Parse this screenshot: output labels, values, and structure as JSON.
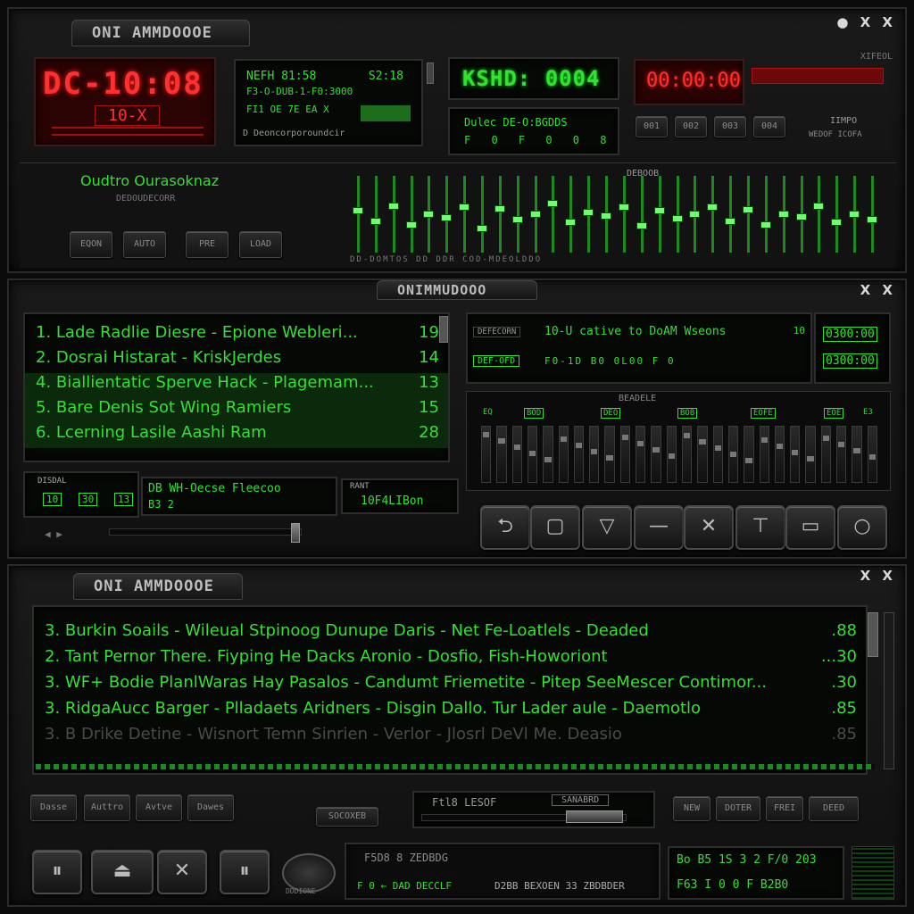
{
  "brand": "ONI AMMDOOOE",
  "brand_mid": "ONIMMUDOOO",
  "window_controls": "● X X",
  "top": {
    "red_display": "DC-10:08",
    "red_sub": "10-X",
    "info_line1": "NEFH 81:58",
    "info_line1_right": "S2:18",
    "info_line2": "F3-O-DUB-1-F0:3000",
    "info_line3": "FI1 OE 7E EA X",
    "info_line4": "D Deoncorporoundcir",
    "green_display": "KSHD: 0004",
    "green_sub": "Dulec DE-O:BGDDS",
    "green_sub2": "F 0 F 0 0 8",
    "red_timer": "00:00:00",
    "right_label": "XIFEOL",
    "right_buttons": [
      "001",
      "002",
      "003",
      "004"
    ],
    "right_caption": "IIMPO",
    "right_caption2": "WEDOF ICOFA"
  },
  "eq": {
    "title": "Oudtro Ourasoknaz",
    "sub": "DEDOUDECORR",
    "buttons": [
      "EQON",
      "AUTO",
      "PRE",
      "LOAD"
    ],
    "center_label": "DEBOOB",
    "bands": [
      0.55,
      0.4,
      0.62,
      0.35,
      0.5,
      0.45,
      0.6,
      0.3,
      0.58,
      0.42,
      0.5,
      0.65,
      0.38,
      0.52,
      0.47,
      0.6,
      0.33,
      0.55,
      0.44,
      0.5,
      0.6,
      0.4,
      0.57,
      0.35,
      0.5,
      0.46,
      0.62,
      0.38,
      0.5,
      0.42
    ],
    "footer": "DD-DOMTOS DD DDR COD-MDEOLDDO"
  },
  "playlist1": {
    "tracks": [
      {
        "title": "1. Lade Radlie Diesre - Epione Webleri...",
        "num": "19",
        "selected": false
      },
      {
        "title": "2. Dosrai Histarat - KriskJerdes",
        "num": "14",
        "selected": false
      },
      {
        "title": "4. Biallientatic Sperve Hack - Plagemam...",
        "num": "13",
        "selected": true
      },
      {
        "title": "5. Bare Denis Sot Wing Ramiers",
        "num": "15",
        "selected": true
      },
      {
        "title": "6. Lcerning Lasile Aashi Ram",
        "num": "28",
        "selected": true
      }
    ],
    "bottom_label": "DISDAL",
    "bottom_nums": [
      "10",
      "30",
      "13"
    ],
    "bottom_info": "DB WH-Oecse Fleecoo",
    "bottom_info2": "B3 2",
    "bottom_right": "10F4LIBon",
    "bottom_right_label": "RANT"
  },
  "mid_right": {
    "label_a": "DEFECORN",
    "text": "10-U cative to DoAM Wseons",
    "num": "10",
    "label_b": "DEF-OFD",
    "sub": "F0-1D B0 0L00 F 0",
    "time1": "0300:00",
    "time2": "0300:00",
    "mixer_title": "BEADELE",
    "mixer_labels": [
      "EQ",
      "BOD",
      "DEO",
      "BOB",
      "EOFE",
      "EOE",
      "E3"
    ]
  },
  "transport": [
    "⮌",
    "▢",
    "▽",
    "—",
    "✕",
    "⊤",
    "▭",
    "○"
  ],
  "playlist2": {
    "tracks": [
      {
        "title": "3. Burkin Soails - Wileual Stpinoog Dunupe Daris - Net Fe-Loatlels - Deaded",
        "num": ".88"
      },
      {
        "title": "2. Tant Pernor There. Fiyping He Dacks Aronio - Dosfio, Fish-Howoriont",
        "num": "...30"
      },
      {
        "title": "3. WF+ Bodie PlanlWaras Hay Pasalos - Candumt Friemetite - Pitep SeeMescer Contimor...",
        "num": ".30"
      },
      {
        "title": "3. RidgaAucc Barger - Plladaets Aridners - Disgin Dallo. Tur Lader aule - Daemotlo",
        "num": ".85"
      },
      {
        "title": "3. B Drike Detine - Wisnort Temn Sinrien - Verlor - Jlosrl DeVl Me. Deasio",
        "num": ".85"
      }
    ],
    "buttons_left": [
      "Dasse",
      "Auttro",
      "Avtve",
      "Dawes"
    ],
    "center_label": "SOCOXEB",
    "center_info": "Ftl8 LESOF",
    "center_right": "SANABRD",
    "buttons_right": [
      "NEW",
      "DOTER",
      "FREI",
      "DEED"
    ]
  },
  "bottom": {
    "buttons": [
      "⏸",
      "⏏",
      "✕",
      "⏸"
    ],
    "knob_label": "DDDIONE",
    "info_line1": "F5D8 8 ZEDBDG",
    "info_line2": "F 0 ← DAD DECCLF",
    "info_line3": "D2BB BEXOEN 33 ZBDBDER",
    "lcd_line1": "Bo B5 1S 3 2 F/0 203",
    "lcd_line2": "F63  I 0 0 F B2B0",
    "accent": "#33e033",
    "alert": "#ff3030"
  }
}
